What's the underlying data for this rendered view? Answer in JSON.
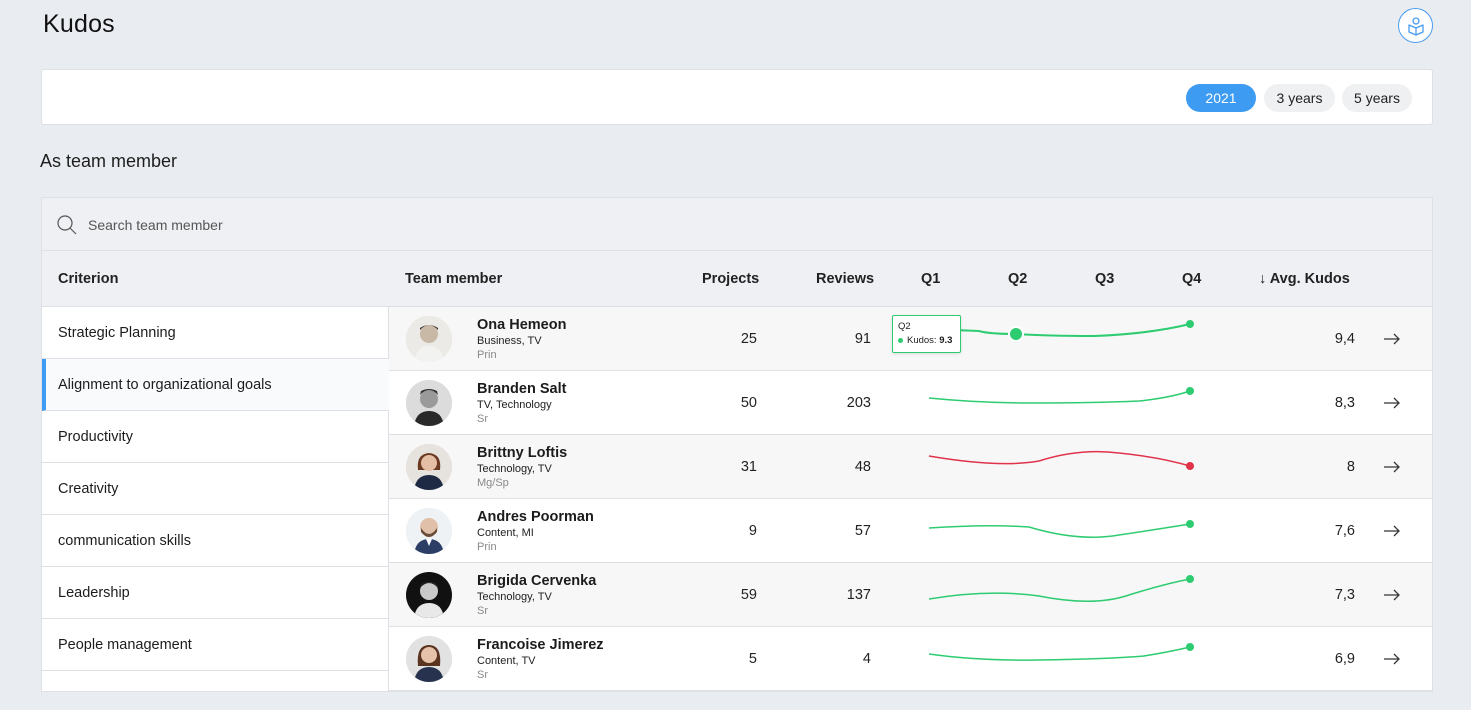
{
  "page": {
    "title": "Kudos"
  },
  "periods": [
    {
      "label": "2021",
      "active": true
    },
    {
      "label": "3 years",
      "active": false
    },
    {
      "label": "5 years",
      "active": false
    }
  ],
  "section": {
    "title": "As team member"
  },
  "search": {
    "placeholder": "Search team member",
    "value": ""
  },
  "columns": {
    "criterion": "Criterion",
    "member": "Team member",
    "projects": "Projects",
    "reviews": "Reviews",
    "q1": "Q1",
    "q2": "Q2",
    "q3": "Q3",
    "q4": "Q4",
    "avg": "↓ Avg. Kudos"
  },
  "criteria": [
    {
      "label": "Strategic Planning",
      "active": false
    },
    {
      "label": "Alignment to organizational goals",
      "active": true
    },
    {
      "label": "Productivity",
      "active": false
    },
    {
      "label": "Creativity",
      "active": false
    },
    {
      "label": "communication skills",
      "active": false
    },
    {
      "label": "Leadership",
      "active": false
    },
    {
      "label": "People management",
      "active": false
    }
  ],
  "members": [
    {
      "name": "Ona Hemeon",
      "dept": "Business, TV",
      "level": "Prin",
      "projects": "25",
      "reviews": "91",
      "avg": "9,4",
      "trend_color": "#2ecc71"
    },
    {
      "name": "Branden Salt",
      "dept": "TV, Technology",
      "level": "Sr",
      "projects": "50",
      "reviews": "203",
      "avg": "8,3",
      "trend_color": "#2ecc71"
    },
    {
      "name": "Brittny Loftis",
      "dept": "Technology, TV",
      "level": "Mg/Sp",
      "projects": "31",
      "reviews": "48",
      "avg": "8",
      "trend_color": "#e0334a"
    },
    {
      "name": "Andres Poorman",
      "dept": "Content, MI",
      "level": "Prin",
      "projects": "9",
      "reviews": "57",
      "avg": "7,6",
      "trend_color": "#2ecc71"
    },
    {
      "name": "Brigida Cervenka",
      "dept": "Technology, TV",
      "level": "Sr",
      "projects": "59",
      "reviews": "137",
      "avg": "7,3",
      "trend_color": "#2ecc71"
    },
    {
      "name": "Francoise Jimerez",
      "dept": "Content, TV",
      "level": "Sr",
      "projects": "5",
      "reviews": "4",
      "avg": "6,9",
      "trend_color": "#2ecc71"
    }
  ],
  "tooltip": {
    "title": "Q2",
    "label": "Kudos:",
    "value": "9.3"
  },
  "colors": {
    "accent": "#3d9bf2",
    "positive": "#2ecc71",
    "negative": "#e0334a"
  },
  "icons": {
    "profile": "user-box-icon",
    "search": "search-icon",
    "row_action": "arrow-right-icon"
  }
}
